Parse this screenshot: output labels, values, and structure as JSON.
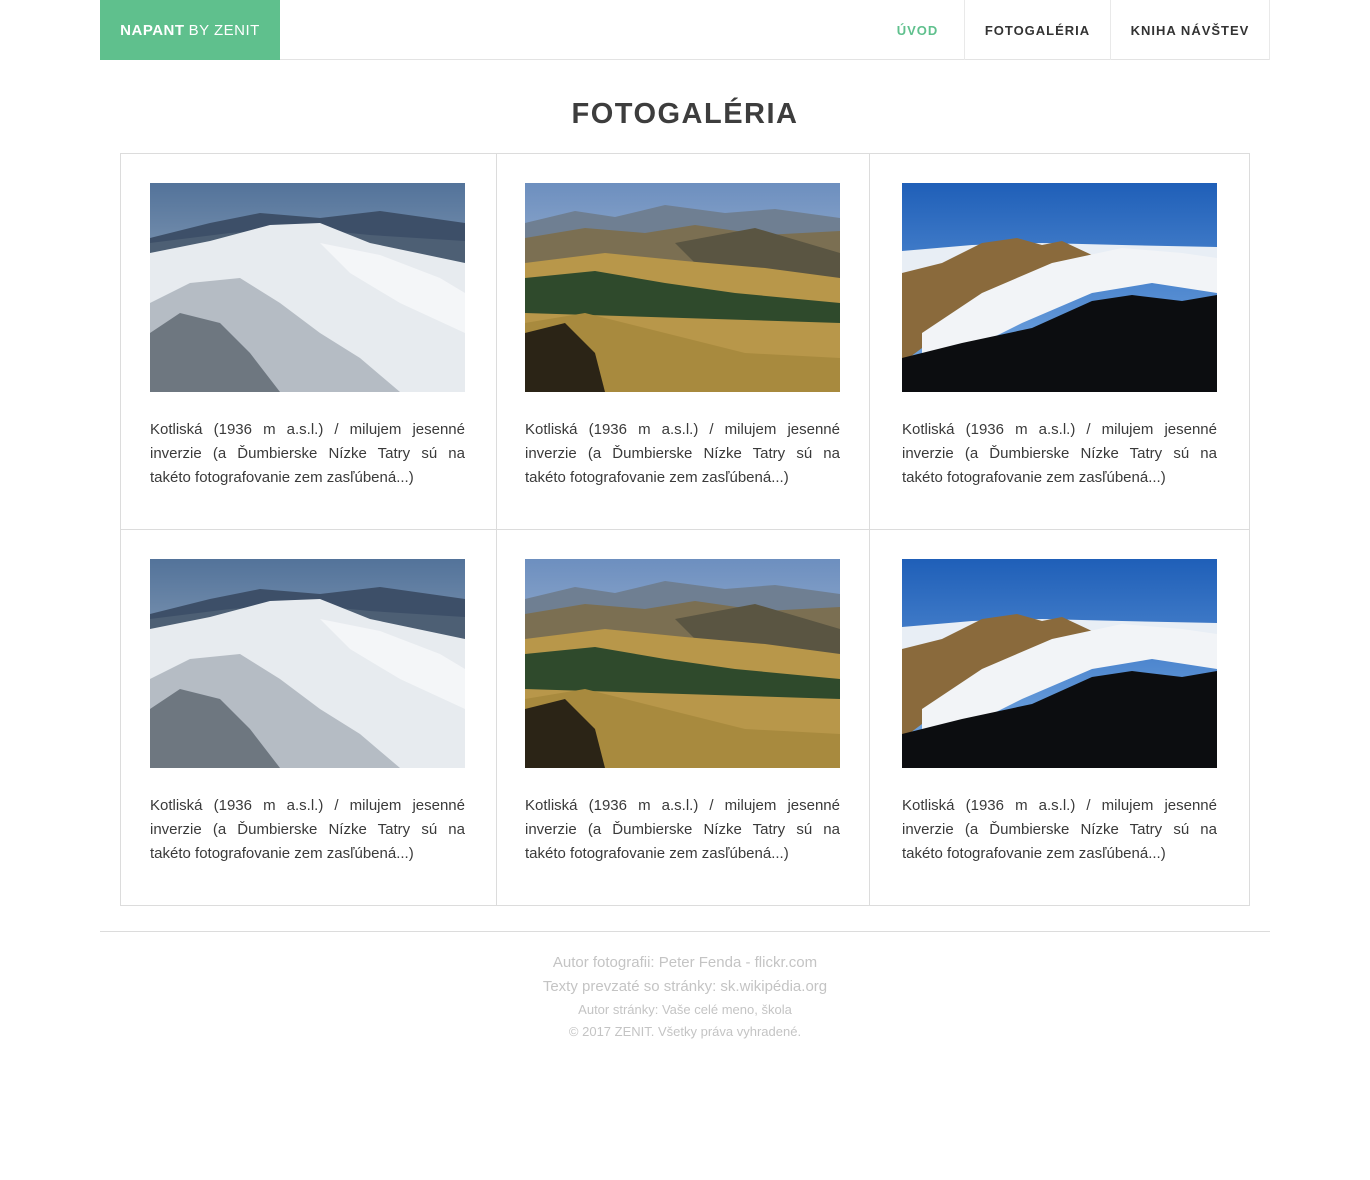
{
  "brand": {
    "strong": "NAPANT",
    "light": "BY ZENIT",
    "color": "#5fc08d"
  },
  "nav": {
    "items": [
      {
        "label": "ÚVOD",
        "active": true
      },
      {
        "label": "FOTOGALÉRIA",
        "active": false
      },
      {
        "label": "KNIHA NÁVŠTEV",
        "active": false
      }
    ]
  },
  "page": {
    "title": "FOTOGALÉRIA"
  },
  "gallery": {
    "items": [
      {
        "photo": "snowy-ridge",
        "caption": "Kotliská (1936 m a.s.l.) / milujem jesenné inverzie (a Ďumbierske Nízke Tatry sú na takéto fotografovanie zem zasľúbená...)"
      },
      {
        "photo": "autumn-meadow",
        "caption": "Kotliská (1936 m a.s.l.) / milujem jesenné inverzie (a Ďumbierske Nízke Tatry sú na takéto fotografovanie zem zasľúbená...)"
      },
      {
        "photo": "cloud-inversion",
        "caption": "Kotliská (1936 m a.s.l.) / milujem jesenné inverzie (a Ďumbierske Nízke Tatry sú na takéto fotografovanie zem zasľúbená...)"
      },
      {
        "photo": "snowy-ridge",
        "caption": "Kotliská (1936 m a.s.l.) / milujem jesenné inverzie (a Ďumbierske Nízke Tatry sú na takéto fotografovanie zem zasľúbená...)"
      },
      {
        "photo": "autumn-meadow",
        "caption": "Kotliská (1936 m a.s.l.) / milujem jesenné inverzie (a Ďumbierske Nízke Tatry sú na takéto fotografovanie zem zasľúbená...)"
      },
      {
        "photo": "cloud-inversion",
        "caption": "Kotliská (1936 m a.s.l.) / milujem jesenné inverzie (a Ďumbierske Nízke Tatry sú na takéto fotografovanie zem zasľúbená...)"
      }
    ]
  },
  "footer": {
    "photo_author": "Autor fotografii: Peter Fenda - flickr.com",
    "texts_source": "Texty prevzaté so stránky: sk.wikipédia.org",
    "site_author": "Autor stránky: Vaše celé meno, škola",
    "copyright": "© 2017 ZENIT. Všetky práva vyhradené."
  }
}
